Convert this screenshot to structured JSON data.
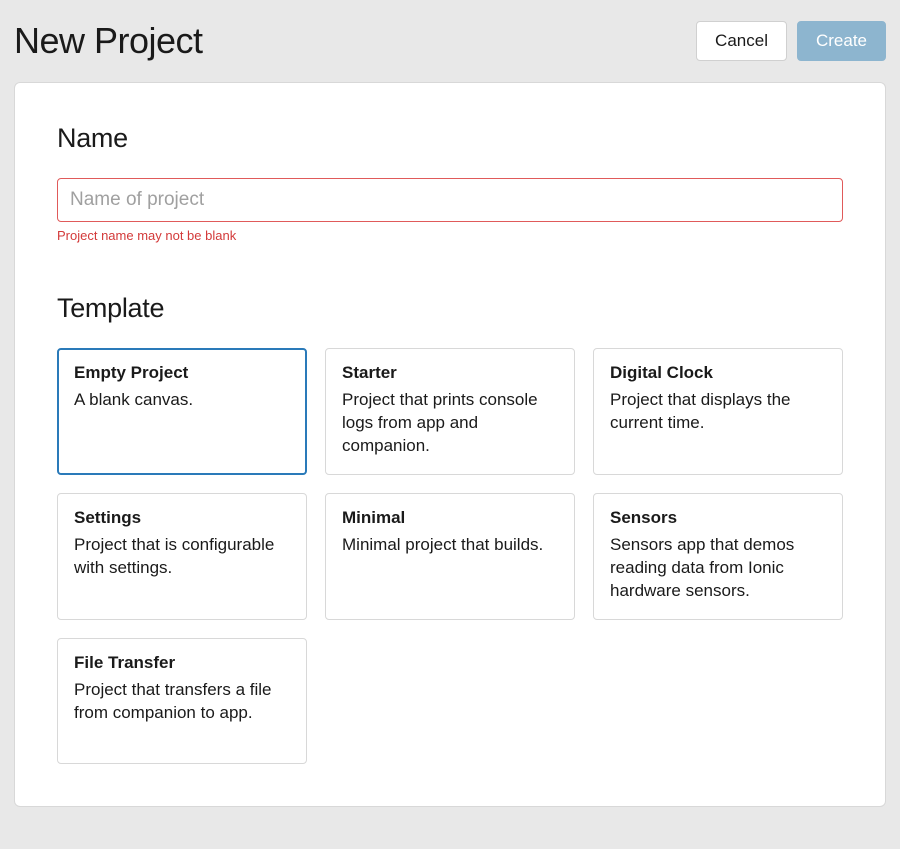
{
  "header": {
    "title": "New Project",
    "cancel_label": "Cancel",
    "create_label": "Create"
  },
  "name_section": {
    "heading": "Name",
    "placeholder": "Name of project",
    "value": "",
    "error": "Project name may not be blank"
  },
  "template_section": {
    "heading": "Template",
    "selected_index": 0,
    "templates": [
      {
        "title": "Empty Project",
        "desc": "A blank canvas."
      },
      {
        "title": "Starter",
        "desc": "Project that prints console logs from app and companion."
      },
      {
        "title": "Digital Clock",
        "desc": "Project that displays the current time."
      },
      {
        "title": "Settings",
        "desc": "Project that is configurable with settings."
      },
      {
        "title": "Minimal",
        "desc": "Minimal project that builds."
      },
      {
        "title": "Sensors",
        "desc": "Sensors app that demos reading data from Ionic hardware sensors."
      },
      {
        "title": "File Transfer",
        "desc": "Project that transfers a file from companion to app."
      }
    ]
  }
}
